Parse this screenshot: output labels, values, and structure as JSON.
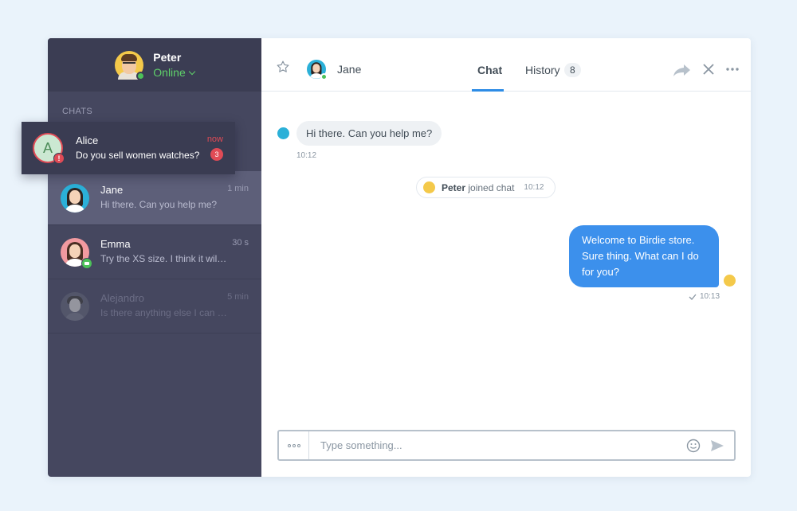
{
  "profile": {
    "name": "Peter",
    "status": "Online"
  },
  "sidebar": {
    "section_label": "CHATS",
    "notification": {
      "avatar_letter": "A",
      "alert_mark": "!",
      "name": "Alice",
      "message": "Do you sell women watches?",
      "time": "now",
      "unread_count": "3"
    },
    "chats": [
      {
        "name": "Jane",
        "message": "Hi there. Can you help me?",
        "time": "1 min"
      },
      {
        "name": "Emma",
        "message": "Try the XS size. I think it will ...",
        "time": "30 s"
      },
      {
        "name": "Alejandro",
        "message": "Is there anything else I can do ...",
        "time": "5 min"
      }
    ]
  },
  "header": {
    "contact_name": "Jane",
    "tabs": [
      {
        "label": "Chat"
      },
      {
        "label": "History",
        "count": "8"
      }
    ]
  },
  "conversation": {
    "incoming": {
      "text": "Hi there. Can you help me?",
      "time": "10:12"
    },
    "system": {
      "name": "Peter",
      "text": "joined chat",
      "time": "10:12"
    },
    "outgoing": {
      "text": "Welcome to Birdie store. Sure thing. What can I do for you?",
      "time": "10:13"
    }
  },
  "composer": {
    "placeholder": "Type something..."
  },
  "colors": {
    "accent": "#3c90ec",
    "sidebar": "#45475f",
    "online": "#4cc159",
    "alert": "#e04b56"
  }
}
